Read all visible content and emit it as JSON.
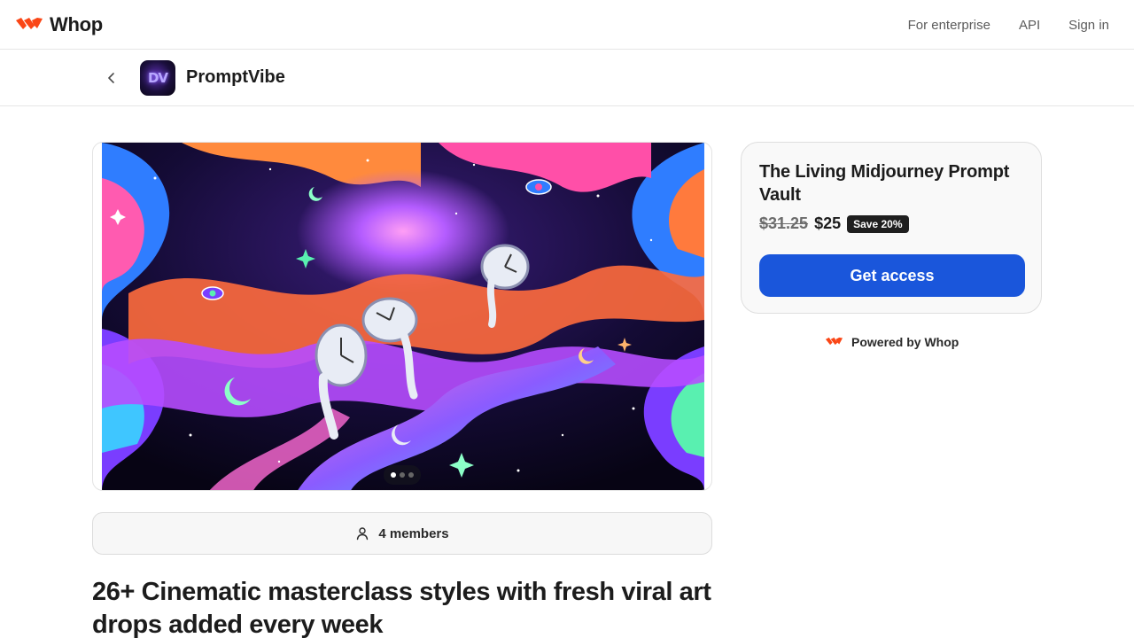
{
  "header": {
    "brand": "Whop",
    "brand_color": "#fa4616",
    "nav": [
      "For enterprise",
      "API",
      "Sign in"
    ]
  },
  "store": {
    "name": "PromptVibe",
    "avatar_letters": "DV",
    "back_icon": "chevron-left-icon"
  },
  "gallery": {
    "slide_count": 3,
    "active_slide": 1
  },
  "members": {
    "icon": "user-icon",
    "label": "4 members"
  },
  "headline": "26+ Cinematic masterclass styles with fresh viral art drops added every week",
  "product": {
    "title": "The Living Midjourney Prompt Vault",
    "old_price": "$31.25",
    "price": "$25",
    "badge": "Save 20%",
    "cta": "Get access",
    "cta_color": "#1a56db"
  },
  "powered_by": "Powered by Whop"
}
